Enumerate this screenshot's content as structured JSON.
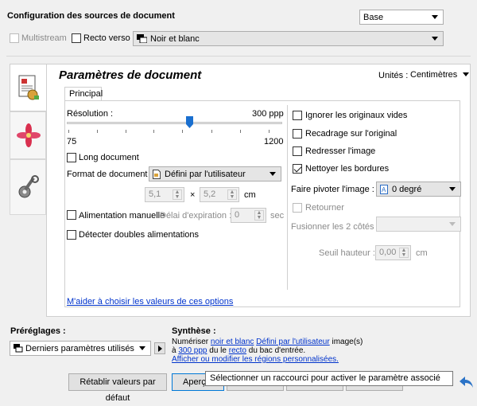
{
  "header": {
    "title": "Configuration des sources de document",
    "preset_select": "Base",
    "multistream_label": "Multistream",
    "recto_verso_label": "Recto verso",
    "color_mode_select": "Noir et blanc"
  },
  "panel": {
    "title": "Paramètres de document",
    "units_label": "Unités :",
    "units_select": "Centimètres",
    "tab_principal": "Principal"
  },
  "resolution": {
    "label": "Résolution :",
    "value_text": "300 ppp",
    "min_label": "75",
    "max_label": "1200",
    "value": 300,
    "min": 75,
    "max": 1200
  },
  "left_options": {
    "long_document": "Long document",
    "format_label": "Format de document :",
    "format_select": "Défini par l'utilisateur",
    "width_value": "5,1",
    "times": "×",
    "height_value": "5,2",
    "unit_cm": "cm",
    "manual_feed": "Alimentation manuelle",
    "timeout_label": "Délai d'expiration :",
    "timeout_value": "0",
    "timeout_unit": "sec",
    "double_feed": "Détecter doubles alimentations"
  },
  "right_options": {
    "ignore_blank": "Ignorer les originaux vides",
    "crop_original": "Recadrage sur l'original",
    "straighten": "Redresser l'image",
    "clean_borders": "Nettoyer les bordures",
    "rotate_label": "Faire pivoter l'image :",
    "rotate_select": "0 degré",
    "flip": "Retourner",
    "merge_label": "Fusionner les 2 côtés :",
    "merge_select": "",
    "threshold_label": "Seuil hauteur :",
    "threshold_value": "0,00",
    "threshold_unit": "cm"
  },
  "help_link": "M'aider à choisir les valeurs de ces options",
  "presets": {
    "label": "Préréglages :",
    "select": "Derniers paramètres utilisés"
  },
  "summary": {
    "label": "Synthèse :",
    "text_pre": "Numériser",
    "link_color": "noir et blanc",
    "link_format": "Défini par l'utilisateur",
    "text_image": "image(s)",
    "text_a": "à",
    "link_res": "300 ppp",
    "text_du_le": "du le",
    "link_side": "recto",
    "text_bac": "du bac d'entrée.",
    "link_regions": "Afficher ou modifier les régions personnalisées."
  },
  "footer": {
    "reset_button": "Rétablir valeurs par défaut",
    "preview_button": "Aperçu",
    "tooltip": "Sélectionner un raccourci pour activer le paramètre associé"
  },
  "colors": {
    "link": "#0033cc",
    "slider_thumb": "#1a6fcf",
    "back_arrow": "#2b73c7"
  }
}
